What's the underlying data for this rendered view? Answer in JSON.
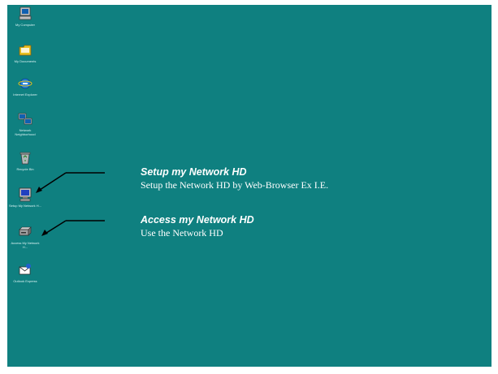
{
  "desktop": {
    "background": "#0f8080",
    "icons": [
      {
        "name": "my-computer",
        "label": "My Computer",
        "icon": "computer-icon"
      },
      {
        "name": "my-documents",
        "label": "My Documents",
        "icon": "folder-icon"
      },
      {
        "name": "internet-explorer",
        "label": "Internet Explorer",
        "icon": "ie-icon"
      },
      {
        "name": "network-neighborhood",
        "label": "Network Neighborhood",
        "icon": "network-icon"
      },
      {
        "name": "recycle-bin",
        "label": "Recycle Bin",
        "icon": "recycle-bin-icon"
      },
      {
        "name": "setup-my-network-hd",
        "label": "Setup My Network H...",
        "icon": "setup-monitor-icon"
      },
      {
        "name": "access-my-network-hd",
        "label": "Access My Network H...",
        "icon": "network-drive-icon"
      },
      {
        "name": "outlook-express",
        "label": "Outlook Express",
        "icon": "outlook-icon"
      }
    ]
  },
  "callouts": [
    {
      "title": "Setup my Network HD",
      "description": "Setup the Network HD by Web-Browser Ex I.E."
    },
    {
      "title": "Access my Network HD",
      "description": "Use the Network HD"
    }
  ]
}
